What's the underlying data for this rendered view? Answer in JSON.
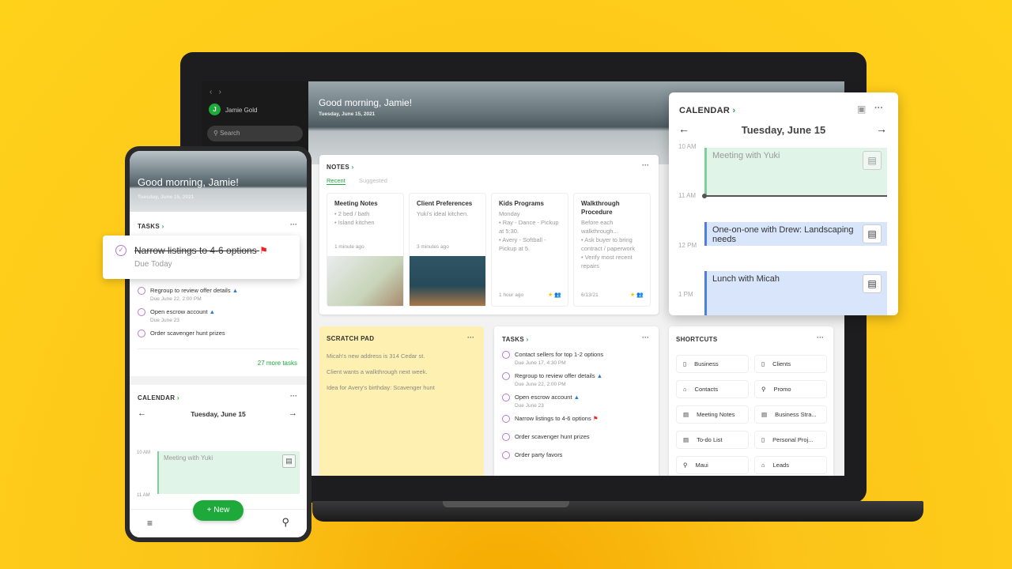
{
  "laptop": {
    "sidebar": {
      "user_initial": "J",
      "user_name": "Jamie Gold",
      "search_placeholder": "Search"
    },
    "hero": {
      "greeting": "Good morning, Jamie!",
      "date": "Tuesday, June 15, 2021"
    },
    "notes": {
      "title": "NOTES",
      "tabs": [
        "Recent",
        "Suggested"
      ],
      "active_tab": "Recent",
      "items": [
        {
          "title": "Meeting Notes",
          "lines": [
            "• 2 bed / bath",
            "• Island kitchen"
          ],
          "time": "1 minute ago"
        },
        {
          "title": "Client Preferences",
          "lines": [
            "Yuki's ideal kitchen."
          ],
          "time": "3 minutes ago"
        },
        {
          "title": "Kids Programs",
          "lines": [
            "Monday",
            "• Ray - Dance - Pickup at 5:30.",
            "• Avery - Softball - Pickup at 5."
          ],
          "time": "1 hour ago"
        },
        {
          "title": "Walkthrough Procedure",
          "lines": [
            "Before each walkthrough...",
            "• Ask buyer to bring contract / paperwork",
            "• Verify most recent repairs"
          ],
          "time": "6/13/21"
        }
      ]
    },
    "scratch": {
      "title": "SCRATCH PAD",
      "lines": [
        "Micah's new address is 314 Cedar st.",
        "Client wants a walkthrough next week.",
        "Idea for Avery's birthday: Scavenger hunt"
      ]
    },
    "tasks": {
      "title": "TASKS",
      "items": [
        {
          "text": "Contact sellers for top 1-2 options",
          "due": "Due June 17, 4:30 PM"
        },
        {
          "text": "Regroup to review offer details",
          "due": "Due June 22, 2:00 PM"
        },
        {
          "text": "Open escrow account",
          "due": "Due June 23"
        },
        {
          "text": "Narrow listings to 4-6 options",
          "due": ""
        },
        {
          "text": "Order scavenger hunt prizes",
          "due": ""
        },
        {
          "text": "Order party favors",
          "due": ""
        }
      ]
    },
    "shortcuts": {
      "title": "SHORTCUTS",
      "items": [
        "Business",
        "Clients",
        "Contacts",
        "Promo",
        "Meeting Notes",
        "Business Stra...",
        "To-do List",
        "Personal Proj...",
        "Maui",
        "Leads"
      ]
    }
  },
  "calendar": {
    "title": "CALENDAR",
    "date": "Tuesday, June 15",
    "times": [
      "10 AM",
      "11 AM",
      "12 PM",
      "1 PM"
    ],
    "events": [
      "Meeting with Yuki",
      "One-on-one with Drew: Landscaping needs",
      "Lunch with Micah"
    ]
  },
  "phone": {
    "greeting": "Good morning, Jamie!",
    "date": "Tuesday, June 15, 2021",
    "tasks_title": "TASKS",
    "featured_task": {
      "text": "Narrow listings to 4-6 options",
      "due": "Due Today"
    },
    "tasks": [
      {
        "text": "Regroup to review offer details",
        "due": "Due June 22, 2:00 PM"
      },
      {
        "text": "Open escrow account",
        "due": "Due June 23"
      },
      {
        "text": "Order scavenger hunt prizes",
        "due": ""
      }
    ],
    "more_tasks": "27 more tasks",
    "calendar_title": "CALENDAR",
    "calendar_date": "Tuesday, June 15",
    "times": [
      "10 AM",
      "11 AM"
    ],
    "event": "Meeting with Yuki",
    "new_button": "New"
  },
  "colors": {
    "accent": "#1eaa3b",
    "background": "#ffd21a",
    "task_circle": "#b57bd1",
    "scratch": "#fdf0b0"
  }
}
